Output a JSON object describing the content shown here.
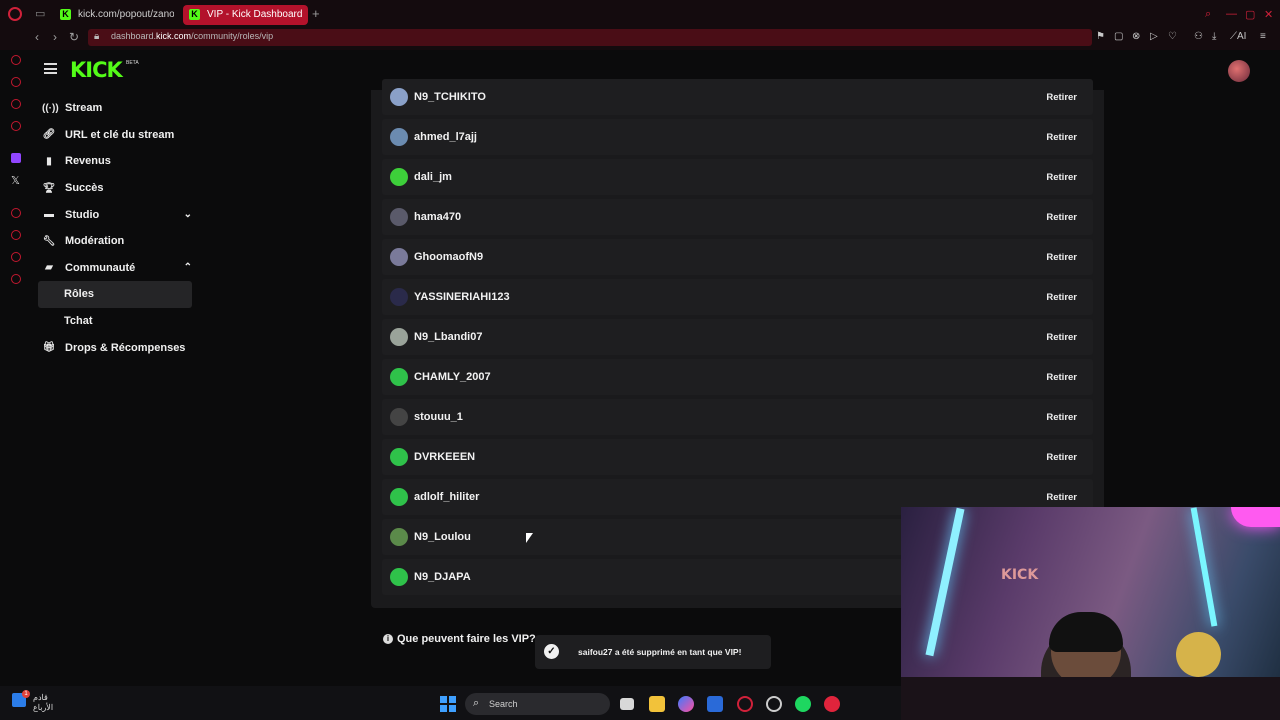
{
  "browser": {
    "tabs": [
      {
        "title": "kick.com/popout/zanoun/"
      },
      {
        "title": "VIP - Kick Dashboard"
      }
    ],
    "url_prefix": "dashboard.",
    "url_host": "kick.com",
    "url_path": "/community/roles/vip",
    "ai_label": "AI"
  },
  "header": {
    "logo": "KICK",
    "beta": "BETA"
  },
  "sidebar": {
    "items": [
      {
        "label": "Stream",
        "icon": "stream-icon"
      },
      {
        "label": "URL et clé du stream",
        "icon": "link-icon"
      },
      {
        "label": "Revenus",
        "icon": "chart-icon"
      },
      {
        "label": "Succès",
        "icon": "trophy-icon"
      },
      {
        "label": "Studio",
        "icon": "studio-icon"
      },
      {
        "label": "Modération",
        "icon": "wrench-icon"
      },
      {
        "label": "Communauté",
        "icon": "community-icon"
      },
      {
        "label": "Rôles"
      },
      {
        "label": "Tchat"
      },
      {
        "label": "Drops & Récompenses",
        "icon": "gift-icon"
      }
    ]
  },
  "vip_list": {
    "remove_label": "Retirer",
    "users": [
      {
        "name": "N9_TCHIKITO",
        "avatar_color": "#8aa0c8",
        "has_remove": true
      },
      {
        "name": "ahmed_l7ajj",
        "avatar_color": "#6b8bb0",
        "has_remove": true
      },
      {
        "name": "dali_jm",
        "avatar_color": "#3dcf3a",
        "has_remove": true
      },
      {
        "name": "hama470",
        "avatar_color": "#5a5a6a",
        "has_remove": true
      },
      {
        "name": "GhoomaofN9",
        "avatar_color": "#7a7a9a",
        "has_remove": true
      },
      {
        "name": "YASSINERIAHI123",
        "avatar_color": "#2a2a4a",
        "has_remove": true
      },
      {
        "name": "N9_Lbandi07",
        "avatar_color": "#9aa39a",
        "has_remove": true
      },
      {
        "name": "CHAMLY_2007",
        "avatar_color": "#2fc24a",
        "has_remove": true
      },
      {
        "name": "stouuu_1",
        "avatar_color": "#444",
        "has_remove": true
      },
      {
        "name": "DVRKEEEN",
        "avatar_color": "#2fc24a",
        "has_remove": true
      },
      {
        "name": "adlolf_hiliter",
        "avatar_color": "#2fc24a",
        "has_remove": true
      },
      {
        "name": "N9_Loulou",
        "avatar_color": "#5b8a4a",
        "has_remove": false
      },
      {
        "name": "N9_DJAPA",
        "avatar_color": "#2fc24a",
        "has_remove": false
      }
    ]
  },
  "info": {
    "question": "Que peuvent faire les VIP?"
  },
  "toast": {
    "message": "saifou27 a été supprimé en tant que VIP!"
  },
  "taskbar": {
    "weather_line1": "قادم",
    "weather_line2": "الأرباع",
    "badge": "1",
    "search_placeholder": "Search"
  }
}
